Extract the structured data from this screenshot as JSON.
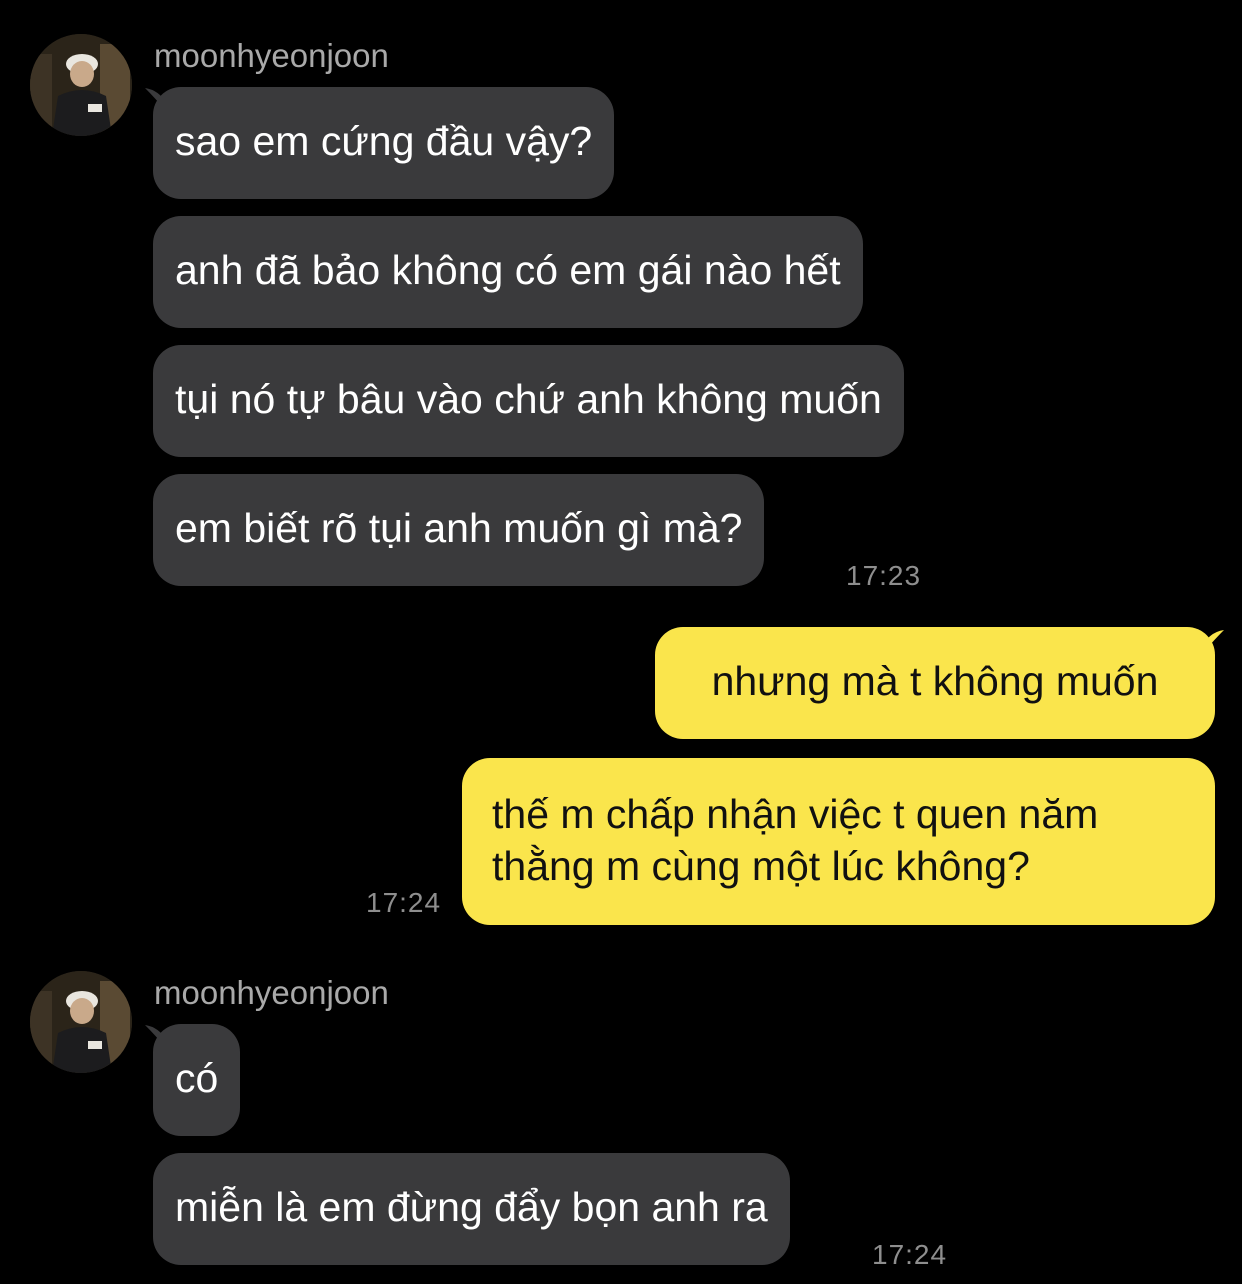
{
  "groups": [
    {
      "sender": "moonhyeonjoon",
      "messages": [
        "sao em cứng đầu vậy?",
        "anh đã bảo không có em gái nào hết",
        "tụi nó tự bâu vào chứ anh không muốn",
        "em biết rõ tụi anh muốn gì mà?"
      ],
      "time": "17:23"
    },
    {
      "messages": [
        "nhưng mà t không muốn",
        "thế m chấp nhận việc t quen năm thằng m cùng một lúc không?"
      ],
      "time": "17:24"
    },
    {
      "sender": "moonhyeonjoon",
      "messages": [
        "có",
        "miễn là em đừng đẩy bọn anh ra"
      ],
      "time": "17:24"
    }
  ],
  "colors": {
    "background": "#000000",
    "incoming_bubble": "#3a3a3c",
    "outgoing_bubble": "#fae54c",
    "timestamp": "#8e8e8e"
  },
  "icons": {
    "avatar": "profile-photo-avatar"
  }
}
